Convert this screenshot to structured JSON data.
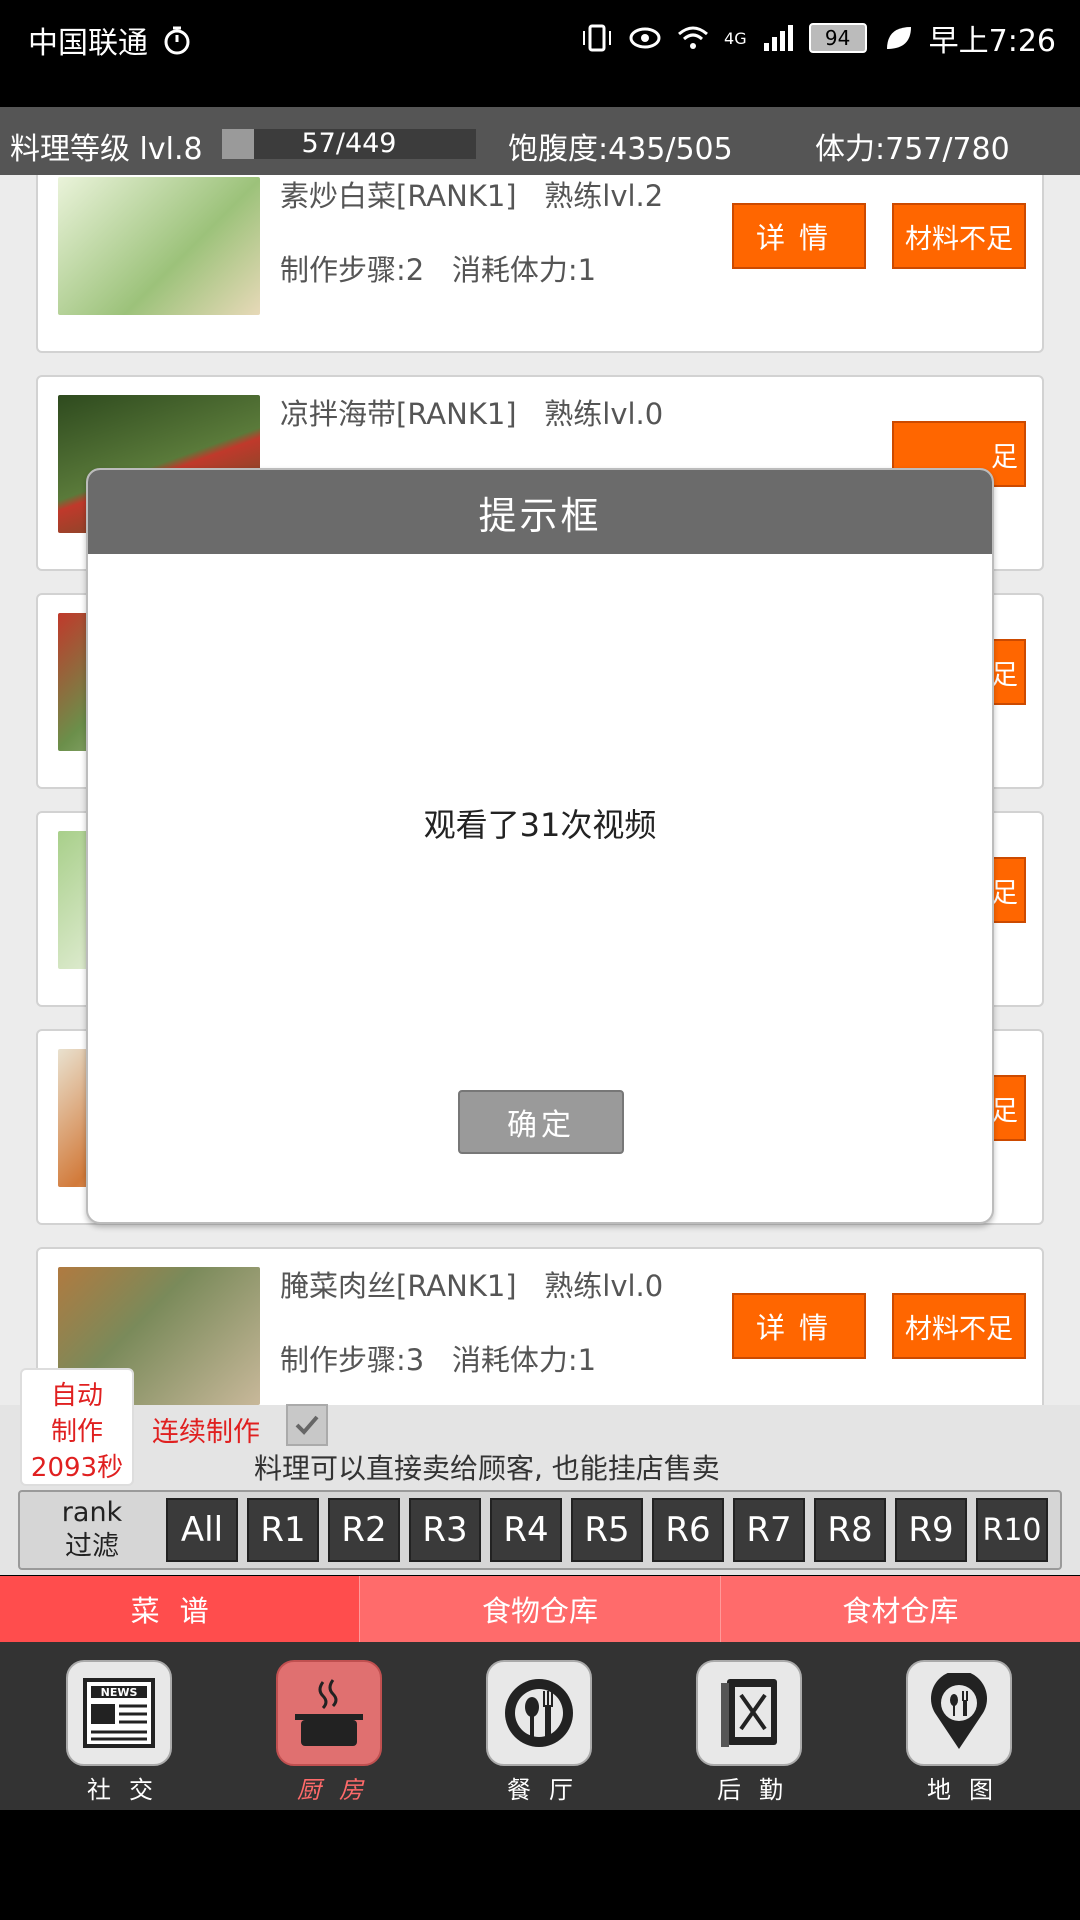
{
  "status_bar": {
    "carrier": "中国联通",
    "network": "4G",
    "battery": "94",
    "time": "早上7:26"
  },
  "info_bar": {
    "cooking_level": "料理等级 lvl.8",
    "xp": "57/449",
    "xp_fraction": 0.127,
    "satiety": "饱腹度:435/505",
    "stamina": "体力:757/780"
  },
  "recipes": [
    {
      "name": "素炒白菜[RANK1]",
      "proficiency": "熟练lvl.2",
      "steps": "制作步骤:2",
      "cost": "消耗体力:1",
      "detail_label": "详情",
      "status_label": "材料不足",
      "thumb_color": "#cfe5b0"
    },
    {
      "name": "凉拌海带[RANK1]",
      "proficiency": "熟练lvl.0",
      "steps": "",
      "cost": "",
      "detail_label": "",
      "status_label": "足",
      "thumb_color": "#3f5a2e"
    },
    {
      "name": "",
      "proficiency": "",
      "steps": "",
      "cost": "",
      "detail_label": "",
      "status_label": "足",
      "thumb_color": "#7a9a5a"
    },
    {
      "name": "",
      "proficiency": "",
      "steps": "",
      "cost": "",
      "detail_label": "",
      "status_label": "足",
      "thumb_color": "#b8d6a0"
    },
    {
      "name": "",
      "proficiency": "",
      "steps": "",
      "cost": "",
      "detail_label": "",
      "status_label": "足",
      "thumb_color": "#d08050"
    },
    {
      "name": "腌菜肉丝[RANK1]",
      "proficiency": "熟练lvl.0",
      "steps": "制作步骤:3",
      "cost": "消耗体力:1",
      "detail_label": "详情",
      "status_label": "材料不足",
      "thumb_color": "#8a7a50"
    }
  ],
  "dialog": {
    "title": "提示框",
    "message": "观看了31次视频",
    "ok_label": "确定"
  },
  "controls": {
    "auto_make": [
      "自动",
      "制作",
      "2093秒"
    ],
    "continuous_label": "连续制作",
    "continuous_checked": true,
    "tip": "料理可以直接卖给顾客, 也能挂店售卖",
    "rank_filter_label": [
      "rank",
      "过滤"
    ],
    "rank_buttons": [
      "All",
      "R1",
      "R2",
      "R3",
      "R4",
      "R5",
      "R6",
      "R7",
      "R8",
      "R9",
      "R10"
    ]
  },
  "sub_tabs": [
    "菜谱",
    "食物仓库",
    "食材仓库"
  ],
  "bottom_nav": [
    {
      "label": "社交",
      "icon": "news-icon",
      "active": false
    },
    {
      "label": "厨房",
      "icon": "cooking-pot-icon",
      "active": true
    },
    {
      "label": "餐厅",
      "icon": "plate-cutlery-icon",
      "active": false
    },
    {
      "label": "后勤",
      "icon": "menu-book-icon",
      "active": false
    },
    {
      "label": "地图",
      "icon": "map-pin-cutlery-icon",
      "active": false
    }
  ],
  "colors": {
    "accent_orange": "#ff6600",
    "tab_red": "#ff6b6b",
    "auto_text_red": "#e02020"
  }
}
